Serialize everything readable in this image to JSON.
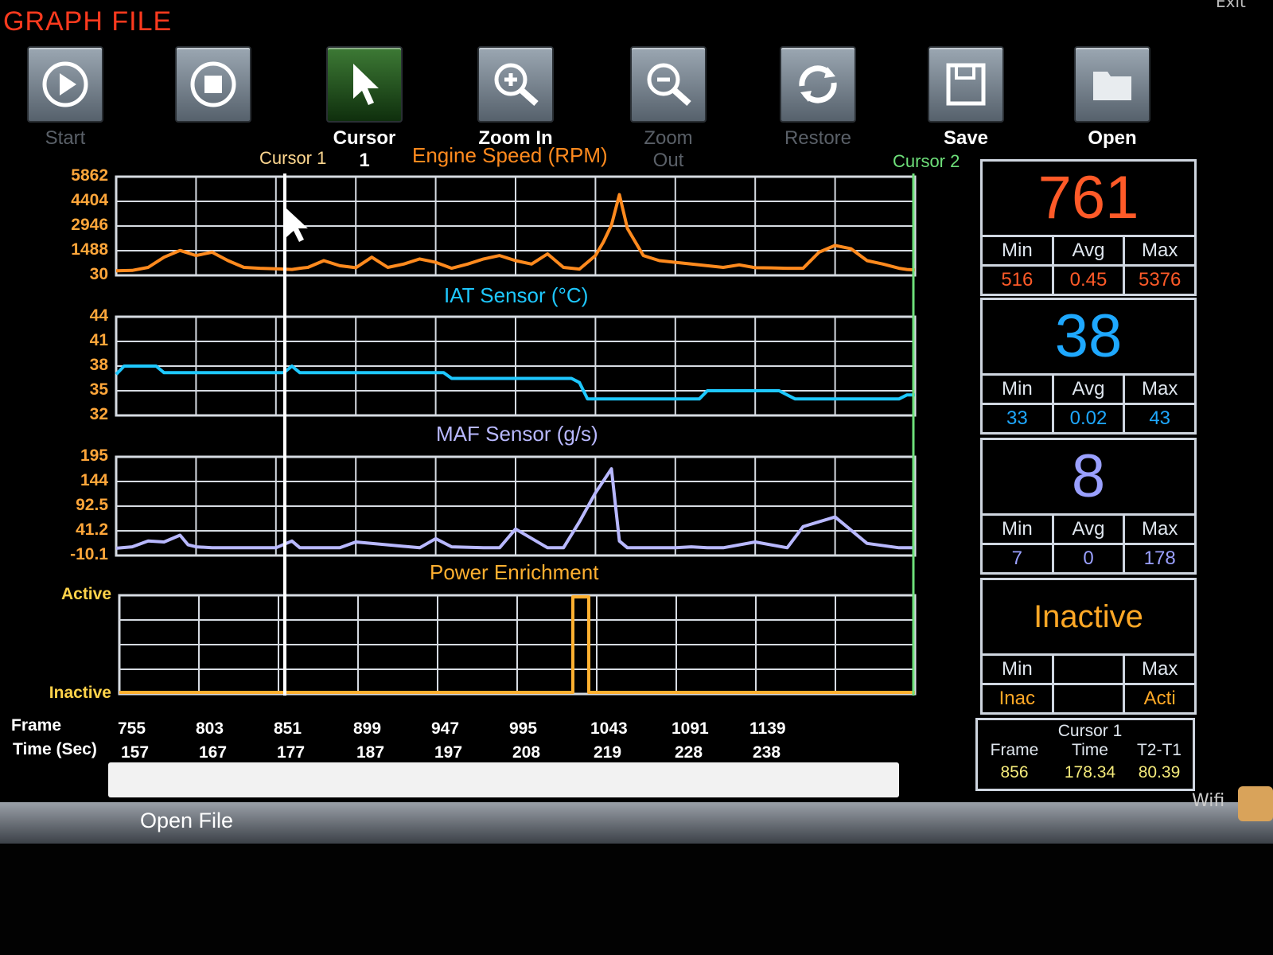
{
  "window": {
    "title": "GRAPH FILE",
    "exit_label": "Exit"
  },
  "toolbar": [
    {
      "id": "start",
      "label": "Start",
      "state": "dim",
      "icon": "play-icon"
    },
    {
      "id": "stop",
      "label": "",
      "state": "plain",
      "icon": "stop-icon"
    },
    {
      "id": "cursor1",
      "label": "Cursor 1",
      "state": "active",
      "icon": "pointer-icon"
    },
    {
      "id": "zoomin",
      "label": "Zoom In",
      "state": "on",
      "icon": "zoom-in-icon"
    },
    {
      "id": "zoomout",
      "label": "Zoom Out",
      "state": "dim",
      "icon": "zoom-out-icon"
    },
    {
      "id": "restore",
      "label": "Restore",
      "state": "dim",
      "icon": "refresh-icon"
    },
    {
      "id": "save",
      "label": "Save",
      "state": "on",
      "icon": "floppy-icon"
    },
    {
      "id": "open",
      "label": "Open",
      "state": "on",
      "icon": "folder-icon"
    }
  ],
  "cursor_labels": {
    "cursor1": "Cursor 1",
    "cursor2": "Cursor 2"
  },
  "colors": {
    "rpm": "#ff8a1e",
    "iat": "#1ec8ff",
    "maf": "#b8b8ff",
    "power": "#ffb030",
    "grid": "#d6dbe2",
    "cursor": "#ffffff"
  },
  "chart_data": [
    {
      "type": "line",
      "title": "Engine Speed (RPM)",
      "yticks": [
        "5862",
        "4404",
        "2946",
        "1488",
        "30"
      ],
      "ylim": [
        30,
        5862
      ],
      "x": [
        0,
        20,
        40,
        60,
        80,
        100,
        120,
        140,
        160,
        180,
        200,
        210,
        220,
        230,
        240,
        260,
        280,
        300,
        320,
        340,
        360,
        380,
        400,
        420,
        440,
        460,
        480,
        500,
        520,
        540,
        560,
        580,
        600,
        610,
        620,
        630,
        640,
        660,
        680,
        700,
        720,
        740,
        760,
        780,
        800,
        820,
        840,
        860,
        880,
        900,
        920,
        940,
        960,
        980,
        990,
        1000
      ],
      "values": [
        300,
        320,
        500,
        1100,
        1500,
        1200,
        1400,
        900,
        500,
        450,
        420,
        400,
        380,
        450,
        500,
        900,
        600,
        480,
        1100,
        500,
        700,
        1000,
        800,
        450,
        700,
        1000,
        1200,
        900,
        700,
        1300,
        500,
        400,
        1200,
        2000,
        3000,
        4800,
        2800,
        1200,
        900,
        800,
        700,
        600,
        500,
        650,
        480,
        470,
        450,
        450,
        1400,
        1800,
        1600,
        900,
        700,
        450,
        380,
        350
      ]
    },
    {
      "type": "line",
      "title": "IAT Sensor (°C)",
      "yticks": [
        "44",
        "41",
        "38",
        "35",
        "32"
      ],
      "ylim": [
        32,
        44
      ],
      "x": [
        0,
        10,
        50,
        60,
        150,
        210,
        220,
        230,
        300,
        410,
        420,
        570,
        580,
        590,
        630,
        730,
        740,
        820,
        830,
        850,
        980,
        990,
        1000
      ],
      "values": [
        37,
        38,
        38,
        37.2,
        37.2,
        37.2,
        38,
        37.2,
        37.2,
        37.2,
        36.5,
        36.5,
        36,
        34,
        34,
        34,
        35,
        35,
        35,
        34,
        34,
        34.5,
        34.5
      ]
    },
    {
      "type": "line",
      "title": "MAF Sensor (g/s)",
      "yticks": [
        "195",
        "144",
        "92.5",
        "41.2",
        "-10.1"
      ],
      "ylim": [
        -10.1,
        195
      ],
      "x": [
        0,
        20,
        40,
        60,
        80,
        90,
        100,
        120,
        160,
        200,
        220,
        230,
        240,
        280,
        300,
        380,
        400,
        420,
        460,
        480,
        500,
        540,
        560,
        580,
        600,
        620,
        630,
        640,
        660,
        680,
        700,
        720,
        740,
        760,
        800,
        840,
        860,
        900,
        940,
        980,
        1000
      ],
      "values": [
        5,
        8,
        20,
        18,
        32,
        12,
        8,
        6,
        6,
        6,
        20,
        6,
        6,
        6,
        18,
        6,
        25,
        8,
        6,
        6,
        45,
        6,
        6,
        60,
        120,
        170,
        20,
        6,
        6,
        6,
        6,
        8,
        6,
        6,
        18,
        6,
        50,
        70,
        15,
        6,
        6
      ]
    },
    {
      "type": "line",
      "title": "Power Enrichment",
      "yticks": [
        "Active",
        "Inactive"
      ],
      "ylim": [
        0,
        1
      ],
      "x": [
        0,
        570,
        570,
        590,
        590,
        1000
      ],
      "values": [
        0,
        0,
        1,
        1,
        0,
        0
      ]
    }
  ],
  "x_axis": {
    "frame_label": "Frame",
    "time_label": "Time (Sec)",
    "frames": [
      "755",
      "803",
      "851",
      "899",
      "947",
      "995",
      "1043",
      "1091",
      "1139"
    ],
    "times": [
      "157",
      "167",
      "177",
      "187",
      "197",
      "208",
      "219",
      "228",
      "238"
    ]
  },
  "panels": [
    {
      "value": "761",
      "h1": "Min",
      "h2": "Avg",
      "h3": "Max",
      "v1": "516",
      "v2": "0.45",
      "v3": "5376",
      "color": "#ff5a28"
    },
    {
      "value": "38",
      "h1": "Min",
      "h2": "Avg",
      "h3": "Max",
      "v1": "33",
      "v2": "0.02",
      "v3": "43",
      "color": "#1ea8ff"
    },
    {
      "value": "8",
      "h1": "Min",
      "h2": "Avg",
      "h3": "Max",
      "v1": "7",
      "v2": "0",
      "v3": "178",
      "color": "#9aa0ff"
    },
    {
      "value": "Inactive",
      "h1": "Min",
      "h2": "",
      "h3": "Max",
      "v1": "Inac",
      "v2": "",
      "v3": "Acti",
      "color": "#ffa826"
    }
  ],
  "cursor_panel": {
    "title": "Cursor 1",
    "frame_label": "Frame",
    "time_label": "Time",
    "delta_label": "T2-T1",
    "frame": "856",
    "time": "178.34",
    "delta": "80.39"
  },
  "statusbar": {
    "open_file": "Open File",
    "wifi": "Wifi"
  }
}
